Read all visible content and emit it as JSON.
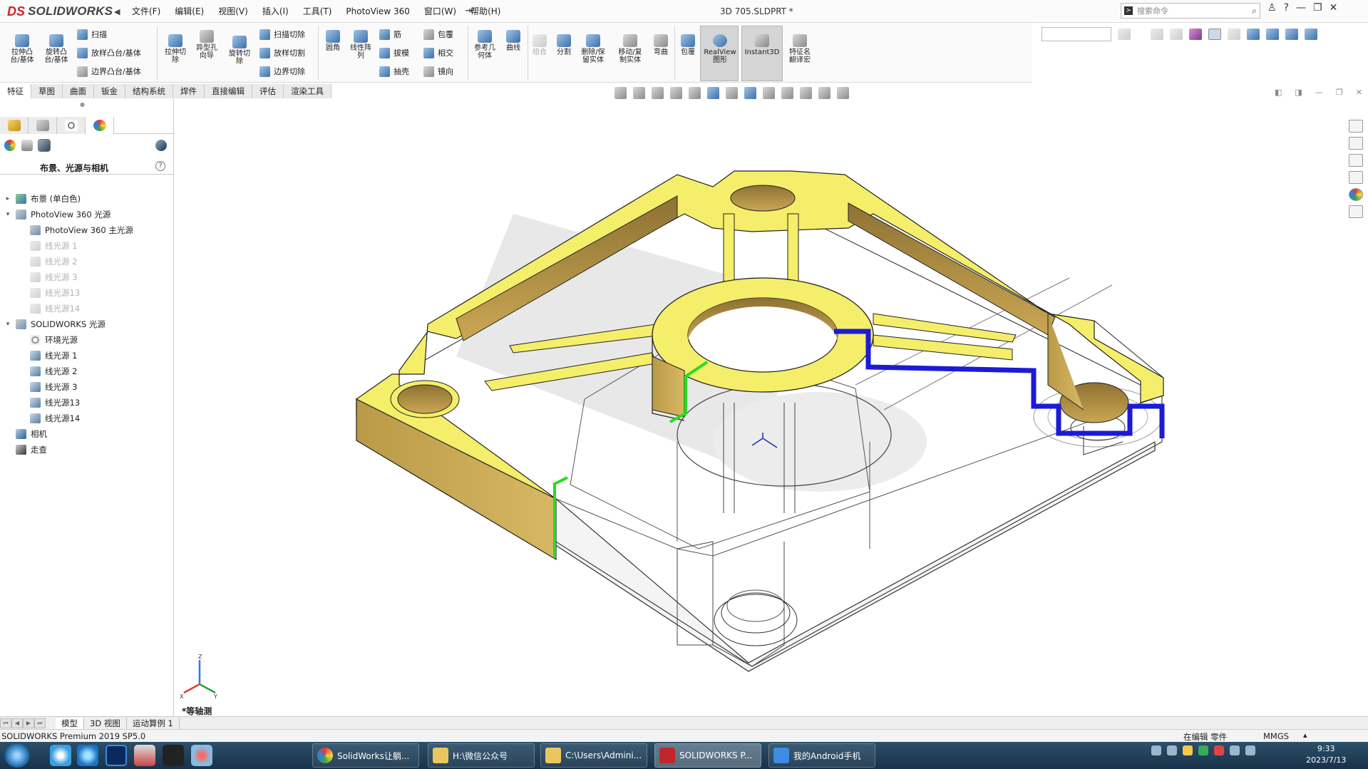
{
  "app": {
    "brand_ds": "DS",
    "brand_name": "SOLIDWORKS",
    "document_title": "3D 705.SLDPRT *"
  },
  "menu": [
    "文件(F)",
    "编辑(E)",
    "视图(V)",
    "插入(I)",
    "工具(T)",
    "PhotoView 360",
    "窗口(W)",
    "帮助(H)"
  ],
  "search": {
    "placeholder": "搜索命令"
  },
  "toolbar": {
    "extrude_boss": "拉伸凸\n台/基体",
    "revolve_boss": "旋转凸\n台/基体",
    "sweep": "扫描",
    "loft_boss": "放样凸台/基体",
    "boundary_boss": "边界凸台/基体",
    "extrude_cut": "拉伸切\n除",
    "hole_wizard": "异型孔\n向导",
    "revolve_cut": "旋转切\n除",
    "sweep_cut": "扫描切除",
    "loft_cut": "放样切割",
    "boundary_cut": "边界切除",
    "fillet": "圆角",
    "linear_pattern": "线性阵\n列",
    "rib": "筋",
    "draft": "拔模",
    "shell": "抽壳",
    "wrap": "包覆",
    "intersect": "相交",
    "mirror": "镜向",
    "ref_geometry": "参考几\n何体",
    "curves": "曲线",
    "combine": "组合",
    "split": "分割",
    "delete_body": "删除/保\n留实体",
    "move_copy": "移动/复\n制实体",
    "flex": "弯曲",
    "wrap2": "包覆",
    "realview": "RealView\n图形",
    "instant3d": "Instant3D",
    "feature_translate": "特征名\n翻译宏"
  },
  "tabs": [
    "特征",
    "草图",
    "曲面",
    "钣金",
    "结构系统",
    "焊件",
    "直接编辑",
    "评估",
    "渲染工具"
  ],
  "panel": {
    "title": "布景、光源与相机",
    "help": "?",
    "tree": [
      {
        "label": "布景 (单白色)",
        "expander": "▸",
        "level": 0,
        "disabled": false,
        "icon": "scene"
      },
      {
        "label": "PhotoView 360 光源",
        "expander": "▾",
        "level": 0,
        "disabled": false,
        "icon": "pv"
      },
      {
        "label": "PhotoView 360 主光源",
        "expander": "",
        "level": 1,
        "disabled": false,
        "icon": "pv"
      },
      {
        "label": "线光源 1",
        "expander": "",
        "level": 1,
        "disabled": true,
        "icon": "dl"
      },
      {
        "label": "线光源 2",
        "expander": "",
        "level": 1,
        "disabled": true,
        "icon": "dl"
      },
      {
        "label": "线光源 3",
        "expander": "",
        "level": 1,
        "disabled": true,
        "icon": "dl"
      },
      {
        "label": "线光源13",
        "expander": "",
        "level": 1,
        "disabled": true,
        "icon": "dl"
      },
      {
        "label": "线光源14",
        "expander": "",
        "level": 1,
        "disabled": true,
        "icon": "dl"
      },
      {
        "label": "SOLIDWORKS 光源",
        "expander": "▾",
        "level": 0,
        "disabled": false,
        "icon": "pv"
      },
      {
        "label": "环境光源",
        "expander": "",
        "level": 1,
        "disabled": false,
        "icon": "lamp"
      },
      {
        "label": "线光源 1",
        "expander": "",
        "level": 1,
        "disabled": false,
        "icon": "dl"
      },
      {
        "label": "线光源 2",
        "expander": "",
        "level": 1,
        "disabled": false,
        "icon": "dl"
      },
      {
        "label": "线光源 3",
        "expander": "",
        "level": 1,
        "disabled": false,
        "icon": "dl"
      },
      {
        "label": "线光源13",
        "expander": "",
        "level": 1,
        "disabled": false,
        "icon": "dl"
      },
      {
        "label": "线光源14",
        "expander": "",
        "level": 1,
        "disabled": false,
        "icon": "dl"
      },
      {
        "label": "相机",
        "expander": "",
        "level": 0,
        "disabled": false,
        "icon": "cam"
      },
      {
        "label": "走查",
        "expander": "",
        "level": 0,
        "disabled": false,
        "icon": "walk"
      }
    ]
  },
  "viewport": {
    "view_name": "*等轴测",
    "triad": {
      "z": "Z",
      "x": "X",
      "y": "Y"
    },
    "colors": {
      "face_top": "#f4ee6a",
      "face_side": "#cfae55",
      "highlight_green": "#22dd22",
      "highlight_blue": "#1b1bd6"
    }
  },
  "bottom_tabs": [
    "模型",
    "3D 视图",
    "运动算例 1"
  ],
  "status": {
    "left": "SOLIDWORKS Premium 2019 SP5.0",
    "edit_mode": "在编辑 零件",
    "units": "MMGS",
    "units_arrow": "▴"
  },
  "taskbar": {
    "tasks": [
      {
        "label": "SolidWorks让躺...",
        "icon_color": "#e4482f"
      },
      {
        "label": "H:\\微信公众号",
        "icon_color": "#e9c760"
      },
      {
        "label": "C:\\Users\\Admini...",
        "icon_color": "#e9c760"
      },
      {
        "label": "SOLIDWORKS P...",
        "icon_color": "#c0272d"
      },
      {
        "label": "我的Android手机",
        "icon_color": "#3b8de0"
      }
    ],
    "time": "9:33",
    "date": "2023/7/13"
  }
}
